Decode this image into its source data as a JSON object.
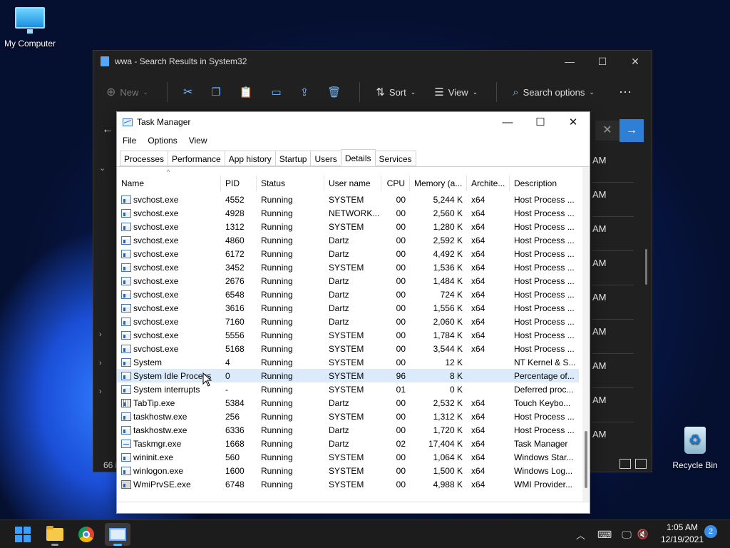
{
  "desktop": {
    "icons": [
      {
        "label": "My Computer"
      },
      {
        "label": "Recycle Bin"
      }
    ]
  },
  "explorer": {
    "title": "wwa - Search Results in System32",
    "toolbar": {
      "new_label": "New",
      "sort_label": "Sort",
      "view_label": "View",
      "search_options_label": "Search options"
    },
    "time_fragments": [
      "AM",
      "AM",
      "AM",
      "AM",
      "AM",
      "AM",
      "AM",
      "AM",
      "AM"
    ],
    "item_count": "66 i"
  },
  "task_manager": {
    "title": "Task Manager",
    "menu": [
      "File",
      "Options",
      "View"
    ],
    "tabs": [
      "Processes",
      "Performance",
      "App history",
      "Startup",
      "Users",
      "Details",
      "Services"
    ],
    "active_tab": "Details",
    "columns": {
      "name": "Name",
      "pid": "PID",
      "status": "Status",
      "user": "User name",
      "cpu": "CPU",
      "memory": "Memory (a...",
      "arch": "Archite...",
      "desc": "Description"
    },
    "rows": [
      {
        "name": "svchost.exe",
        "pid": "4552",
        "status": "Running",
        "user": "SYSTEM",
        "cpu": "00",
        "mem": "5,244 K",
        "arch": "x64",
        "desc": "Host Process ...",
        "icon": "service"
      },
      {
        "name": "svchost.exe",
        "pid": "4928",
        "status": "Running",
        "user": "NETWORK...",
        "cpu": "00",
        "mem": "2,560 K",
        "arch": "x64",
        "desc": "Host Process ...",
        "icon": "service"
      },
      {
        "name": "svchost.exe",
        "pid": "1312",
        "status": "Running",
        "user": "SYSTEM",
        "cpu": "00",
        "mem": "1,280 K",
        "arch": "x64",
        "desc": "Host Process ...",
        "icon": "service"
      },
      {
        "name": "svchost.exe",
        "pid": "4860",
        "status": "Running",
        "user": "Dartz",
        "cpu": "00",
        "mem": "2,592 K",
        "arch": "x64",
        "desc": "Host Process ...",
        "icon": "service"
      },
      {
        "name": "svchost.exe",
        "pid": "6172",
        "status": "Running",
        "user": "Dartz",
        "cpu": "00",
        "mem": "4,492 K",
        "arch": "x64",
        "desc": "Host Process ...",
        "icon": "service"
      },
      {
        "name": "svchost.exe",
        "pid": "3452",
        "status": "Running",
        "user": "SYSTEM",
        "cpu": "00",
        "mem": "1,536 K",
        "arch": "x64",
        "desc": "Host Process ...",
        "icon": "service"
      },
      {
        "name": "svchost.exe",
        "pid": "2676",
        "status": "Running",
        "user": "Dartz",
        "cpu": "00",
        "mem": "1,484 K",
        "arch": "x64",
        "desc": "Host Process ...",
        "icon": "service"
      },
      {
        "name": "svchost.exe",
        "pid": "6548",
        "status": "Running",
        "user": "Dartz",
        "cpu": "00",
        "mem": "724 K",
        "arch": "x64",
        "desc": "Host Process ...",
        "icon": "service"
      },
      {
        "name": "svchost.exe",
        "pid": "3616",
        "status": "Running",
        "user": "Dartz",
        "cpu": "00",
        "mem": "1,556 K",
        "arch": "x64",
        "desc": "Host Process ...",
        "icon": "service"
      },
      {
        "name": "svchost.exe",
        "pid": "7160",
        "status": "Running",
        "user": "Dartz",
        "cpu": "00",
        "mem": "2,060 K",
        "arch": "x64",
        "desc": "Host Process ...",
        "icon": "service"
      },
      {
        "name": "svchost.exe",
        "pid": "5556",
        "status": "Running",
        "user": "SYSTEM",
        "cpu": "00",
        "mem": "1,784 K",
        "arch": "x64",
        "desc": "Host Process ...",
        "icon": "service"
      },
      {
        "name": "svchost.exe",
        "pid": "5168",
        "status": "Running",
        "user": "SYSTEM",
        "cpu": "00",
        "mem": "3,544 K",
        "arch": "x64",
        "desc": "Host Process ...",
        "icon": "service"
      },
      {
        "name": "System",
        "pid": "4",
        "status": "Running",
        "user": "SYSTEM",
        "cpu": "00",
        "mem": "12 K",
        "arch": "",
        "desc": "NT Kernel & S...",
        "icon": "service"
      },
      {
        "name": "System Idle Process",
        "pid": "0",
        "status": "Running",
        "user": "SYSTEM",
        "cpu": "96",
        "mem": "8 K",
        "arch": "",
        "desc": "Percentage of...",
        "icon": "service",
        "selected": true
      },
      {
        "name": "System interrupts",
        "pid": "-",
        "status": "Running",
        "user": "SYSTEM",
        "cpu": "01",
        "mem": "0 K",
        "arch": "",
        "desc": "Deferred proc...",
        "icon": "service"
      },
      {
        "name": "TabTip.exe",
        "pid": "5384",
        "status": "Running",
        "user": "Dartz",
        "cpu": "00",
        "mem": "2,532 K",
        "arch": "x64",
        "desc": "Touch Keybo...",
        "icon": "keyboard"
      },
      {
        "name": "taskhostw.exe",
        "pid": "256",
        "status": "Running",
        "user": "SYSTEM",
        "cpu": "00",
        "mem": "1,312 K",
        "arch": "x64",
        "desc": "Host Process ...",
        "icon": "service"
      },
      {
        "name": "taskhostw.exe",
        "pid": "6336",
        "status": "Running",
        "user": "Dartz",
        "cpu": "00",
        "mem": "1,720 K",
        "arch": "x64",
        "desc": "Host Process ...",
        "icon": "service"
      },
      {
        "name": "Taskmgr.exe",
        "pid": "1668",
        "status": "Running",
        "user": "Dartz",
        "cpu": "02",
        "mem": "17,404 K",
        "arch": "x64",
        "desc": "Task Manager",
        "icon": "taskmgr"
      },
      {
        "name": "wininit.exe",
        "pid": "560",
        "status": "Running",
        "user": "SYSTEM",
        "cpu": "00",
        "mem": "1,064 K",
        "arch": "x64",
        "desc": "Windows Star...",
        "icon": "service"
      },
      {
        "name": "winlogon.exe",
        "pid": "1600",
        "status": "Running",
        "user": "SYSTEM",
        "cpu": "00",
        "mem": "1,500 K",
        "arch": "x64",
        "desc": "Windows Log...",
        "icon": "service"
      },
      {
        "name": "WmiPrvSE.exe",
        "pid": "6748",
        "status": "Running",
        "user": "SYSTEM",
        "cpu": "00",
        "mem": "4,988 K",
        "arch": "x64",
        "desc": "WMI Provider...",
        "icon": "wmi"
      }
    ]
  },
  "taskbar": {
    "clock_time": "1:05 AM",
    "clock_date": "12/19/2021",
    "notification_count": "2",
    "accent_color": "#4cc2ff"
  }
}
